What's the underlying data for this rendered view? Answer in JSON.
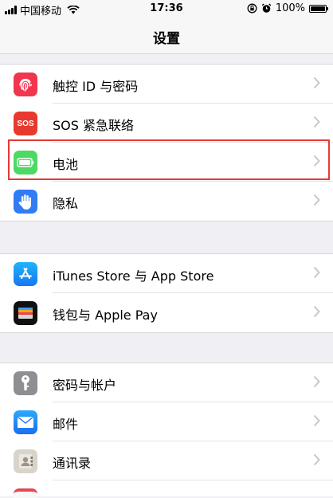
{
  "status_bar": {
    "carrier": "中国移动",
    "time": "17:36",
    "battery": "100%"
  },
  "nav": {
    "title": "设置"
  },
  "groups": [
    {
      "items": [
        {
          "label": "触控 ID 与密码",
          "icon": "fingerprint-icon",
          "color": "#f2354f"
        },
        {
          "label": "SOS 紧急联络",
          "icon": "sos-icon",
          "color": "#e7392d",
          "icon_text": "SOS"
        },
        {
          "label": "电池",
          "icon": "battery-icon",
          "color": "#4cd964"
        },
        {
          "label": "隐私",
          "icon": "hand-icon",
          "color": "#2f7cf6"
        }
      ]
    },
    {
      "items": [
        {
          "label": "iTunes Store 与 App Store",
          "icon": "app-store-icon",
          "color": "#1c8ef9"
        },
        {
          "label": "钱包与 Apple Pay",
          "icon": "wallet-icon",
          "color": "#111111"
        }
      ]
    },
    {
      "items": [
        {
          "label": "密码与帐户",
          "icon": "key-icon",
          "color": "#8e8e93"
        },
        {
          "label": "邮件",
          "icon": "mail-icon",
          "color": "#1e88f5"
        },
        {
          "label": "通讯录",
          "icon": "contacts-icon",
          "color": "#c7c1b6"
        }
      ]
    }
  ]
}
